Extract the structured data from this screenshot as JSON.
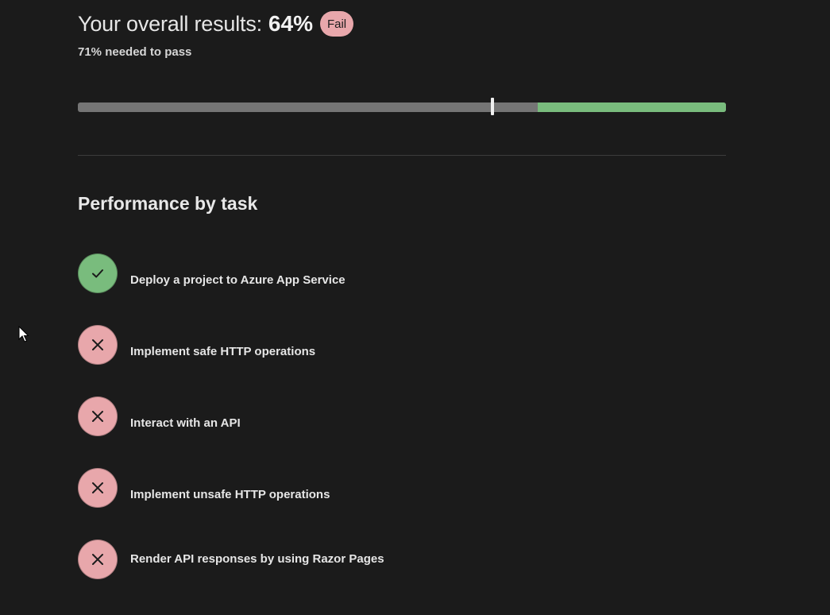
{
  "results": {
    "title": "Your overall results:",
    "score": "64%",
    "status_badge": "Fail",
    "pass_note": "71% needed to pass",
    "score_fraction": 0.64,
    "pass_threshold_fraction": 0.71,
    "colors": {
      "fail": "#e8a7ab",
      "pass": "#79bc7d",
      "track": "#757575"
    }
  },
  "section": {
    "title": "Performance by task"
  },
  "tasks": [
    {
      "label": "Deploy a project to Azure App Service",
      "status": "pass",
      "icon": "check-icon"
    },
    {
      "label": "Implement safe HTTP operations",
      "status": "fail",
      "icon": "x-icon"
    },
    {
      "label": "Interact with an API",
      "status": "fail",
      "icon": "x-icon"
    },
    {
      "label": "Implement unsafe HTTP operations",
      "status": "fail",
      "icon": "x-icon"
    },
    {
      "label": "Render API responses by using Razor Pages",
      "status": "fail",
      "icon": "x-icon"
    }
  ]
}
